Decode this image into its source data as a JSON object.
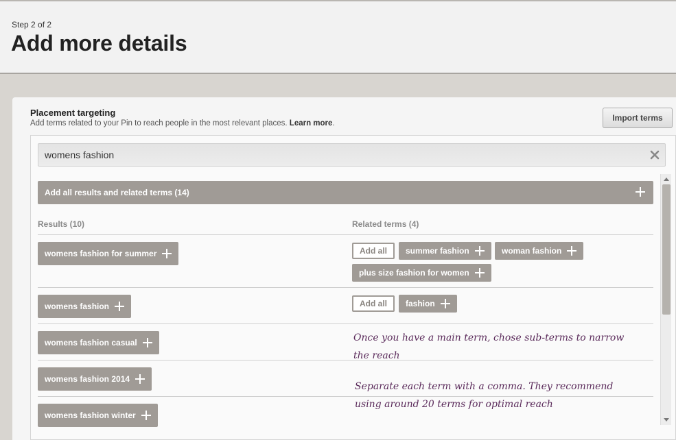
{
  "header": {
    "step": "Step 2 of 2",
    "title": "Add more details"
  },
  "placement": {
    "title": "Placement targeting",
    "subtitle": "Add terms related to your Pin to reach people in the most relevant places.",
    "learn_more": "Learn more",
    "import_label": "Import terms"
  },
  "search": {
    "value": "womens fashion"
  },
  "add_all_bar": {
    "label": "Add all results and related terms (14)"
  },
  "results": {
    "header": "Results (10)",
    "items": [
      "womens fashion for summer",
      "womens fashion",
      "womens fashion casual",
      "womens fashion 2014",
      "womens fashion winter"
    ]
  },
  "related": {
    "header": "Related terms (4)",
    "add_all_label": "Add all",
    "group1": [
      "summer fashion",
      "woman fashion",
      "plus size fashion for women"
    ],
    "group2": [
      "fashion"
    ]
  },
  "notes": {
    "note1_line1": "Once you have a main term, chose sub-terms to narrow",
    "note1_line2": "the reach",
    "note2_line1": "Separate each term with a comma. They recommend",
    "note2_line2": "using around 20 terms for optimal reach"
  },
  "colors": {
    "chip": "#a09b96",
    "note_text": "#5a2a5a"
  }
}
